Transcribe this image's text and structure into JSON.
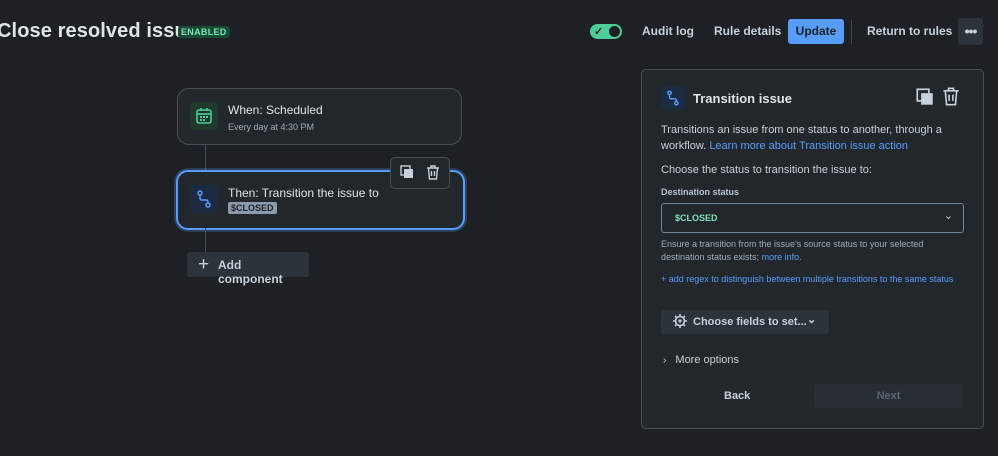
{
  "header": {
    "title": "Close resolved issue",
    "status_badge": "ENABLED",
    "audit_log": "Audit log",
    "rule_details": "Rule details",
    "update": "Update",
    "return_to_rules": "Return to rules",
    "more": "•••"
  },
  "canvas": {
    "trigger": {
      "title": "When: Scheduled",
      "subtitle": "Every day at 4:30 PM",
      "icon": "calendar-icon"
    },
    "action": {
      "title": "Then: Transition the issue to",
      "status": "$CLOSED",
      "icon": "transition-icon"
    },
    "add_component": "Add component"
  },
  "panel": {
    "title": "Transition issue",
    "description": "Transitions an issue from one status to another, through a workflow.",
    "learn_more": "Learn more about Transition issue action",
    "choose_status": "Choose the status to transition the issue to:",
    "destination_label": "Destination status",
    "destination_value": "$CLOSED",
    "helper_text": "Ensure a transition from the issue's source status to your selected destination status exists;",
    "helper_link": "more info.",
    "regex_link": "+ add regex to distinguish between multiple transitions to the same status",
    "choose_fields": "Choose fields to set...",
    "more_options": "More options",
    "back": "Back",
    "next": "Next"
  },
  "colors": {
    "accent": "#579dff",
    "success": "#4bce97",
    "background": "#1d2125"
  }
}
